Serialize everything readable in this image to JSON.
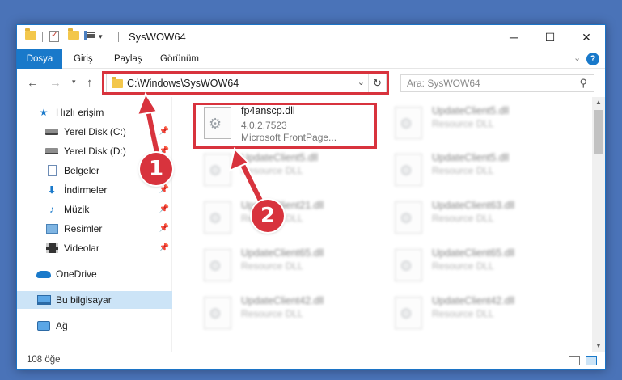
{
  "window": {
    "title": "SysWOW64",
    "minimize_icon": "minimize-icon",
    "maximize_icon": "maximize-icon",
    "close_icon": "close-icon"
  },
  "ribbon": {
    "tabs": [
      {
        "label": "Dosya",
        "active": true
      },
      {
        "label": "Giriş"
      },
      {
        "label": "Paylaş"
      },
      {
        "label": "Görünüm"
      }
    ],
    "help": "?"
  },
  "navigation": {
    "address": "C:\\Windows\\SysWOW64",
    "search_placeholder": "Ara: SysWOW64"
  },
  "sidebar": {
    "items": [
      {
        "label": "Hızlı erişim"
      },
      {
        "label": "Yerel Disk (C:)"
      },
      {
        "label": "Yerel Disk (D:)"
      },
      {
        "label": "Belgeler"
      },
      {
        "label": "İndirmeler"
      },
      {
        "label": "Müzik"
      },
      {
        "label": "Resimler"
      },
      {
        "label": "Videolar"
      },
      {
        "label": "OneDrive"
      },
      {
        "label": "Bu bilgisayar"
      },
      {
        "label": "Ağ"
      }
    ]
  },
  "files": [
    {
      "name": "fp4anscp.dll",
      "line2": "4.0.2.7523",
      "line3": "Microsoft FrontPage..."
    },
    {
      "name": "UpdateClient5.dll",
      "line2": "Resource DLL"
    },
    {
      "name": "UpdateClient5.dll",
      "line2": "Resource DLL"
    },
    {
      "name": "UpdateClient5.dll",
      "line2": "Resource DLL"
    },
    {
      "name": "UpdateClient21.dll",
      "line2": "Resource DLL"
    },
    {
      "name": "UpdateClient63.dll",
      "line2": "Resource DLL"
    },
    {
      "name": "UpdateClient65.dll",
      "line2": "Resource DLL"
    },
    {
      "name": "UpdateClient65.dll",
      "line2": "Resource DLL"
    },
    {
      "name": "UpdateClient42.dll",
      "line2": "Resource DLL"
    },
    {
      "name": "UpdateClient42.dll",
      "line2": "Resource DLL"
    }
  ],
  "status": {
    "item_count": "108 öğe"
  },
  "annotations": {
    "marker1": "1",
    "marker2": "2"
  },
  "colors": {
    "accent": "#1979ca",
    "highlight": "#d8333d",
    "selected": "#cce4f7"
  }
}
